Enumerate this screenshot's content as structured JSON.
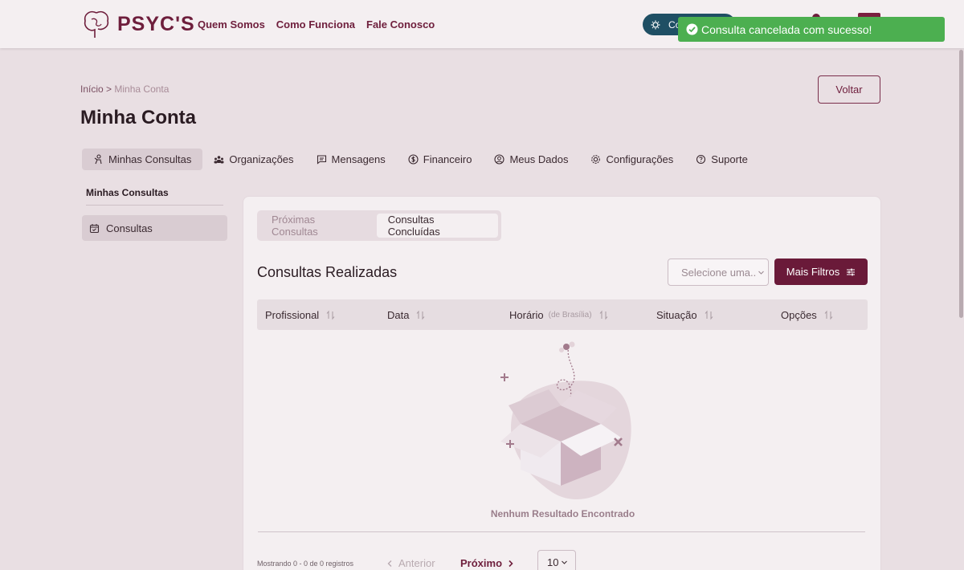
{
  "header": {
    "brand": "PSYC'S",
    "nav": [
      "Quem Somos",
      "Como Funciona",
      "Fale Conosco"
    ],
    "pill_label": "Co"
  },
  "toast": {
    "message": "Consulta cancelada com sucesso!"
  },
  "breadcrumb": {
    "home": "Início",
    "separator": ">",
    "current": "Minha Conta"
  },
  "page": {
    "title": "Minha Conta",
    "back_label": "Voltar"
  },
  "main_tabs": [
    "Minhas Consultas",
    "Organizações",
    "Mensagens",
    "Financeiro",
    "Meus Dados",
    "Configurações",
    "Suporte"
  ],
  "sidebar": {
    "title": "Minhas Consultas",
    "items": [
      "Consultas"
    ]
  },
  "card": {
    "subtabs": [
      "Próximas Consultas",
      "Consultas Concluídas"
    ],
    "active_subtab": "Consultas Concluídas",
    "title": "Consultas Realizadas",
    "select_placeholder": "Selecione uma..",
    "filters_label": "Mais Filtros",
    "columns": [
      {
        "label": "Profissional",
        "hint": ""
      },
      {
        "label": "Data",
        "hint": ""
      },
      {
        "label": "Horário",
        "hint": "(de Brasília)"
      },
      {
        "label": "Situação",
        "hint": ""
      },
      {
        "label": "Opções",
        "hint": ""
      }
    ],
    "empty_message": "Nenhum Resultado Encontrado",
    "pagination": {
      "info": "Mostrando 0 - 0 de 0 registros",
      "prev": "Anterior",
      "next": "Próximo",
      "page_size": "10"
    }
  },
  "colors": {
    "brand": "#6e1e3c",
    "toast": "#4caf50",
    "accent_pill": "#1f4f64"
  }
}
